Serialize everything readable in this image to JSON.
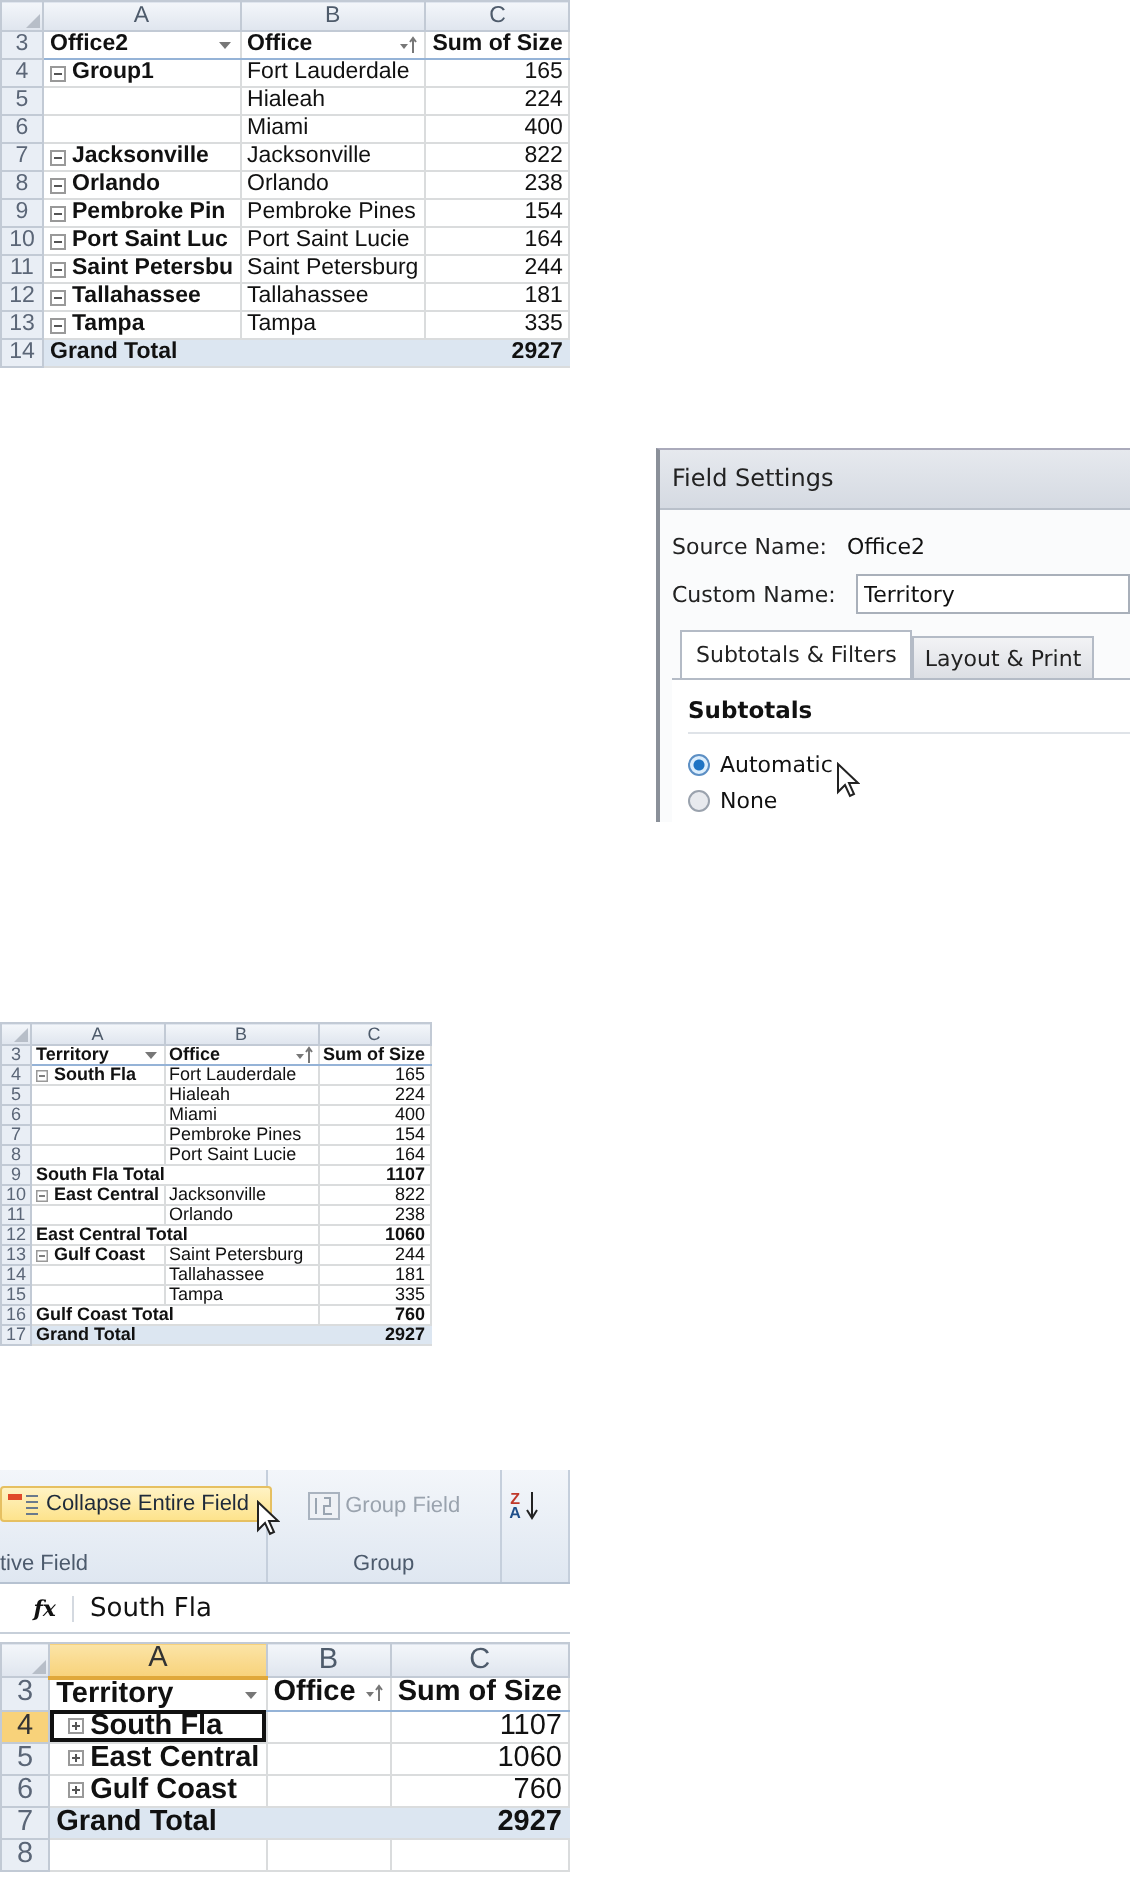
{
  "panels": [
    {
      "kind": "pivot",
      "columns": [
        {
          "label": "A"
        },
        {
          "label": "B"
        },
        {
          "label": "C"
        }
      ],
      "header": {
        "row": "3",
        "cells": [
          {
            "text": "Office2",
            "dropdown": true
          },
          {
            "text": "Office",
            "sorted": true
          },
          {
            "text": "Sum of Size"
          }
        ]
      },
      "rows": [
        {
          "row": "4",
          "kind": "item",
          "label": "Group1",
          "expanded": true,
          "office": "Fort Lauderdale",
          "value": "165"
        },
        {
          "row": "5",
          "kind": "item",
          "office": "Hialeah",
          "value": "224"
        },
        {
          "row": "6",
          "kind": "item",
          "office": "Miami",
          "value": "400"
        },
        {
          "row": "7",
          "kind": "item",
          "label": "Jacksonville",
          "expanded": true,
          "office": "Jacksonville",
          "value": "822"
        },
        {
          "row": "8",
          "kind": "item",
          "label": "Orlando",
          "expanded": true,
          "office": "Orlando",
          "value": "238"
        },
        {
          "row": "9",
          "kind": "item",
          "label": "Pembroke Pin",
          "expanded": true,
          "office": "Pembroke Pines",
          "value": "154"
        },
        {
          "row": "10",
          "kind": "item",
          "label": "Port Saint Luc",
          "expanded": true,
          "office": "Port Saint Lucie",
          "value": "164"
        },
        {
          "row": "11",
          "kind": "item",
          "label": "Saint Petersbu",
          "expanded": true,
          "office": "Saint Petersburg",
          "value": "244"
        },
        {
          "row": "12",
          "kind": "item",
          "label": "Tallahassee",
          "expanded": true,
          "office": "Tallahassee",
          "value": "181"
        },
        {
          "row": "13",
          "kind": "item",
          "label": "Tampa",
          "expanded": true,
          "office": "Tampa",
          "value": "335"
        },
        {
          "row": "14",
          "kind": "grand",
          "label": "Grand Total",
          "value": "2927"
        }
      ]
    },
    {
      "kind": "dialog",
      "title": "Field Settings",
      "source_label": "Source Name:",
      "source_value": "Office2",
      "custom_label": "Custom Name:",
      "custom_value": "Territory",
      "tabs": [
        {
          "label": "Subtotals & Filters",
          "selected": true
        },
        {
          "label": "Layout & Print",
          "selected": false
        }
      ],
      "section": "Subtotals",
      "options": [
        {
          "label": "Automatic",
          "selected": true
        },
        {
          "label": "None",
          "selected": false
        }
      ]
    },
    {
      "kind": "pivot",
      "columns": [
        {
          "label": "A"
        },
        {
          "label": "B"
        },
        {
          "label": "C"
        }
      ],
      "header": {
        "row": "3",
        "cells": [
          {
            "text": "Territory",
            "dropdown": true
          },
          {
            "text": "Office",
            "sorted": true
          },
          {
            "text": "Sum of Size"
          }
        ]
      },
      "rows": [
        {
          "row": "4",
          "kind": "item",
          "label": "South Fla",
          "expanded": true,
          "office": "Fort Lauderdale",
          "value": "165"
        },
        {
          "row": "5",
          "kind": "item",
          "office": "Hialeah",
          "value": "224"
        },
        {
          "row": "6",
          "kind": "item",
          "office": "Miami",
          "value": "400"
        },
        {
          "row": "7",
          "kind": "item",
          "office": "Pembroke Pines",
          "value": "154"
        },
        {
          "row": "8",
          "kind": "item",
          "office": "Port Saint Lucie",
          "value": "164"
        },
        {
          "row": "9",
          "kind": "subtotal",
          "label": "South Fla Total",
          "value": "1107"
        },
        {
          "row": "10",
          "kind": "item",
          "label": "East Central",
          "expanded": true,
          "office": "Jacksonville",
          "value": "822"
        },
        {
          "row": "11",
          "kind": "item",
          "office": "Orlando",
          "value": "238"
        },
        {
          "row": "12",
          "kind": "subtotal",
          "label": "East Central Total",
          "value": "1060"
        },
        {
          "row": "13",
          "kind": "item",
          "label": "Gulf Coast",
          "expanded": true,
          "office": "Saint Petersburg",
          "value": "244"
        },
        {
          "row": "14",
          "kind": "item",
          "office": "Tallahassee",
          "value": "181"
        },
        {
          "row": "15",
          "kind": "item",
          "office": "Tampa",
          "value": "335"
        },
        {
          "row": "16",
          "kind": "subtotal",
          "label": "Gulf Coast Total",
          "value": "760"
        },
        {
          "row": "17",
          "kind": "grand",
          "label": "Grand Total",
          "value": "2927"
        }
      ]
    },
    {
      "kind": "excel",
      "ribbon": {
        "groups": [
          {
            "label": "tive Field",
            "buttons": [
              {
                "kind": "collapse",
                "label": "Collapse Entire Field",
                "hover": true,
                "disabled": false
              }
            ]
          },
          {
            "label": "Group",
            "buttons": [
              {
                "kind": "group",
                "label": "Group Field",
                "hover": false,
                "disabled": true
              }
            ]
          },
          {
            "buttons": [
              {
                "kind": "sort",
                "label": "Z",
                "label2": "A",
                "hover": false
              }
            ]
          }
        ]
      },
      "formula": {
        "fx": "fx",
        "value": "South Fla"
      },
      "grid": {
        "columns": [
          {
            "label": "A",
            "selected": true
          },
          {
            "label": "B",
            "selected": false
          },
          {
            "label": "C",
            "selected": false
          }
        ],
        "header": {
          "row": "3",
          "cells": [
            {
              "text": "Territory",
              "dropdown": true
            },
            {
              "text": "Office",
              "sorted": true
            },
            {
              "text": "Sum of Size"
            }
          ]
        },
        "rows": [
          {
            "row": "4",
            "kind": "item",
            "label": "South Fla",
            "expanded": false,
            "value": "1107",
            "selected": true
          },
          {
            "row": "5",
            "kind": "item",
            "label": "East Central",
            "expanded": false,
            "value": "1060",
            "selected": false
          },
          {
            "row": "6",
            "kind": "item",
            "label": "Gulf Coast",
            "expanded": false,
            "value": "760",
            "selected": false
          },
          {
            "row": "7",
            "kind": "grand",
            "label": "Grand Total",
            "value": "2927",
            "selected": false
          },
          {
            "row": "8",
            "kind": "empty",
            "selected": false
          }
        ]
      }
    }
  ]
}
